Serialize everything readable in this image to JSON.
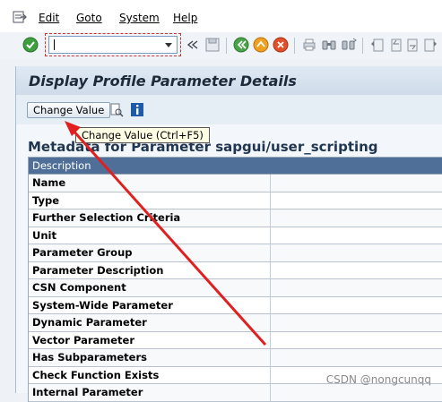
{
  "menu": {
    "items": [
      {
        "label": "Edit"
      },
      {
        "label": "Goto"
      },
      {
        "label": "System"
      },
      {
        "label": "Help"
      }
    ]
  },
  "toolbar": {
    "command_value": "",
    "icons": [
      "check-icon",
      "back-arrows-icon",
      "save-icon",
      "back-icon",
      "exit-icon",
      "cancel-icon",
      "print-icon",
      "find-icon",
      "find-next-icon",
      "first-page-icon",
      "previous-page-icon",
      "next-page-icon",
      "last-page-icon"
    ]
  },
  "page": {
    "title": "Display Profile Parameter Details"
  },
  "appbar": {
    "change_value_label": "Change Value",
    "tooltip": "Change Value   (Ctrl+F5)"
  },
  "metadata": {
    "title": "Metadata for Parameter sapgui/user_scripting",
    "header": "Description",
    "rows": [
      {
        "label": "Name"
      },
      {
        "label": "Type"
      },
      {
        "label": "Further Selection Criteria"
      },
      {
        "label": "Unit"
      },
      {
        "label": "Parameter Group"
      },
      {
        "label": "Parameter Description"
      },
      {
        "label": "CSN Component"
      },
      {
        "label": "System-Wide Parameter"
      },
      {
        "label": "Dynamic Parameter"
      },
      {
        "label": "Vector Parameter"
      },
      {
        "label": "Has Subparameters"
      },
      {
        "label": "Check Function Exists"
      },
      {
        "label": "Internal Parameter"
      }
    ]
  },
  "watermark": "CSDN @nongcunqq",
  "colors": {
    "accent_header": "#4f6f98",
    "annotation_arrow": "#e02020"
  }
}
